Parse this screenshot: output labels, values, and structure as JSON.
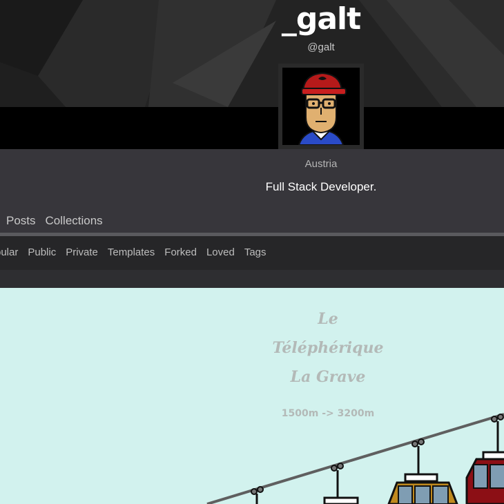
{
  "profile": {
    "username": "_galt",
    "handle": "@galt",
    "location": "Austria",
    "bio": "Full Stack Developer."
  },
  "tabs": [
    {
      "label": "Posts"
    },
    {
      "label": "Collections"
    }
  ],
  "subnav": [
    {
      "label": "pular"
    },
    {
      "label": "Public"
    },
    {
      "label": "Private"
    },
    {
      "label": "Templates"
    },
    {
      "label": "Forked"
    },
    {
      "label": "Loved"
    },
    {
      "label": "Tags"
    }
  ],
  "preview": {
    "line1": "Le",
    "line2": "Téléphérique",
    "line3": "La Grave",
    "line4": "1500m -> 3200m"
  },
  "colors": {
    "preview_bg": "#d2f2ee",
    "gondola_red": "#8c0f15",
    "gondola_orange": "#c08a1e",
    "window_blue": "#7f9db3"
  }
}
